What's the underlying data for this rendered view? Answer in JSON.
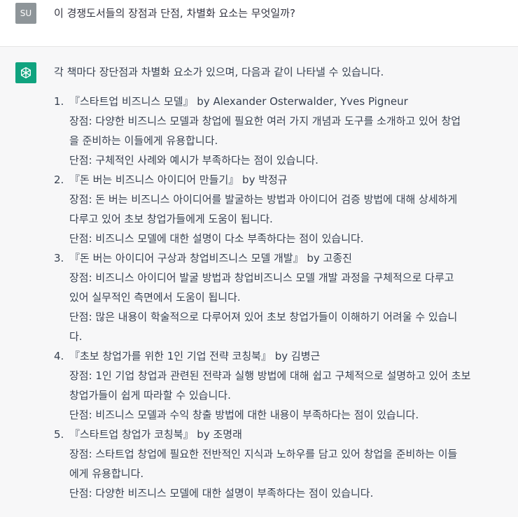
{
  "user": {
    "avatar_initials": "SU",
    "message": "이 경쟁도서들의 장점과 단점, 차별화 요소는 무엇일까?"
  },
  "assistant": {
    "avatar_icon": "openai-logo-icon",
    "intro": "각 책마다 장단점과 차별화 요소가 있으며, 다음과 같이 나타낼 수 있습니다.",
    "items": [
      {
        "num": "1.",
        "title": "『스타트업 비즈니스 모델』 by Alexander Osterwalder, Yves Pigneur",
        "pro_lines": [
          "장점: 다양한 비즈니스 모델과 창업에 필요한 여러 가지 개념과 도구를 소개하고 있어 창업",
          "을 준비하는 이들에게 유용합니다."
        ],
        "con_lines": [
          "단점: 구체적인 사례와 예시가 부족하다는 점이 있습니다."
        ]
      },
      {
        "num": "2.",
        "title": "『돈 버는 비즈니스 아이디어 만들기』 by 박정규",
        "pro_lines": [
          "장점: 돈 버는 비즈니스 아이디어를 발굴하는 방법과 아이디어 검증 방법에 대해 상세하게",
          "다루고 있어 초보 창업가들에게 도움이 됩니다."
        ],
        "con_lines": [
          "단점: 비즈니스 모델에 대한 설명이 다소 부족하다는 점이 있습니다."
        ]
      },
      {
        "num": "3.",
        "title": "『돈 버는 아이디어 구상과 창업비즈니스 모델 개발』 by 고종진",
        "pro_lines": [
          "장점: 비즈니스 아이디어 발굴 방법과 창업비즈니스 모델 개발 과정을 구체적으로 다루고",
          "있어 실무적인 측면에서 도움이 됩니다."
        ],
        "con_lines": [
          "단점: 많은 내용이 학술적으로 다루어져 있어 초보 창업가들이 이해하기 어려울 수 있습니",
          "다."
        ]
      },
      {
        "num": "4.",
        "title": "『초보 창업가를 위한 1인 기업 전략 코칭북』 by 김병근",
        "pro_lines": [
          "장점: 1인 기업 창업과 관련된 전략과 실행 방법에 대해 쉽고 구체적으로 설명하고 있어 초보",
          "창업가들이 쉽게 따라할 수 있습니다."
        ],
        "con_lines": [
          "단점: 비즈니스 모델과 수익 창출 방법에 대한 내용이 부족하다는 점이 있습니다."
        ]
      },
      {
        "num": "5.",
        "title": "『스타트업 창업가 코칭북』 by 조명래",
        "pro_lines": [
          "장점: 스타트업 창업에 필요한 전반적인 지식과 노하우를 담고 있어 창업을 준비하는 이들",
          "에게 유용합니다."
        ],
        "con_lines": [
          "단점: 다양한 비즈니스 모델에 대한 설명이 부족하다는 점이 있습니다."
        ]
      }
    ]
  },
  "colors": {
    "bot_avatar_bg": "#10a37f",
    "user_avatar_bg": "#8e9599",
    "assistant_bg": "#f7f7f8",
    "user_bg": "#ffffff"
  }
}
